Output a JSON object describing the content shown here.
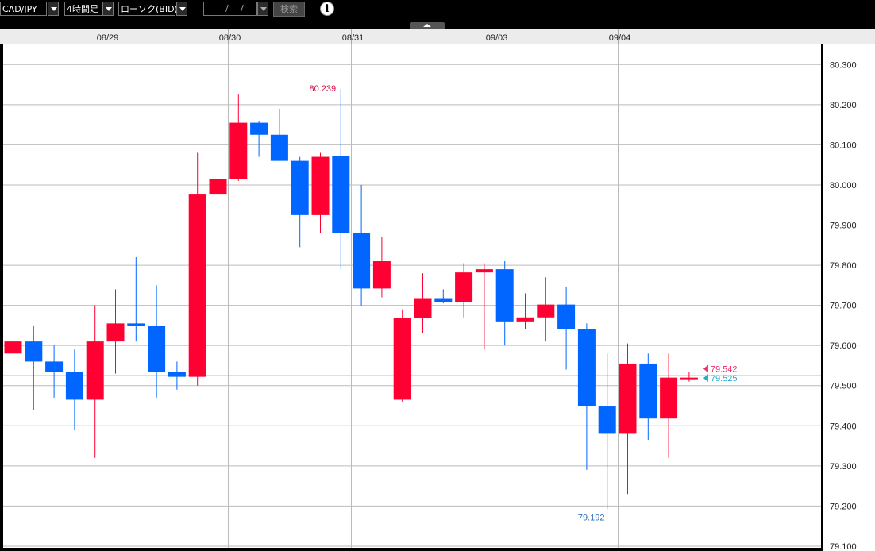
{
  "toolbar": {
    "pair": "CAD/JPY",
    "timeframe": "4時間足",
    "chart_style": "ローソク(BID)",
    "date_placeholder_slash1": "/",
    "date_placeholder_slash2": "/",
    "search_label": "検索",
    "info_label": "i"
  },
  "colors": {
    "up": "#ff0033",
    "down": "#0066ff",
    "grid": "#bbbbbb",
    "price_line": "#ff9933",
    "ask_marker": "#e8306a",
    "bid_marker": "#22aacc",
    "high_label": "#cc1144",
    "low_label": "#2a6fc0"
  },
  "chart_data": {
    "type": "candlestick",
    "x_tick_labels": [
      {
        "label": "08/29",
        "index": 5
      },
      {
        "label": "08/30",
        "index": 11
      },
      {
        "label": "08/31",
        "index": 17
      },
      {
        "label": "09/03",
        "index": 24
      },
      {
        "label": "09/04",
        "index": 30
      }
    ],
    "y_ticks": [
      80.3,
      80.2,
      80.1,
      80.0,
      79.9,
      79.8,
      79.7,
      79.6,
      79.5,
      79.4,
      79.3,
      79.2,
      79.1
    ],
    "y_tick_labels": [
      "80.300",
      "80.200",
      "80.100",
      "80.000",
      "79.900",
      "79.800",
      "79.700",
      "79.600",
      "79.500",
      "79.400",
      "79.300",
      "79.200",
      "79.100"
    ],
    "ylim": [
      79.096,
      80.35
    ],
    "grid": true,
    "candles": [
      {
        "o": 79.58,
        "h": 79.64,
        "l": 79.49,
        "c": 79.61
      },
      {
        "o": 79.61,
        "h": 79.65,
        "l": 79.44,
        "c": 79.56
      },
      {
        "o": 79.56,
        "h": 79.6,
        "l": 79.47,
        "c": 79.535
      },
      {
        "o": 79.535,
        "h": 79.59,
        "l": 79.39,
        "c": 79.465
      },
      {
        "o": 79.465,
        "h": 79.7,
        "l": 79.32,
        "c": 79.61
      },
      {
        "o": 79.61,
        "h": 79.74,
        "l": 79.53,
        "c": 79.655
      },
      {
        "o": 79.655,
        "h": 79.82,
        "l": 79.61,
        "c": 79.648
      },
      {
        "o": 79.648,
        "h": 79.75,
        "l": 79.47,
        "c": 79.535
      },
      {
        "o": 79.535,
        "h": 79.56,
        "l": 79.49,
        "c": 79.522
      },
      {
        "o": 79.522,
        "h": 80.08,
        "l": 79.5,
        "c": 79.978
      },
      {
        "o": 79.978,
        "h": 80.13,
        "l": 79.8,
        "c": 80.015
      },
      {
        "o": 80.015,
        "h": 80.225,
        "l": 80.01,
        "c": 80.155
      },
      {
        "o": 80.155,
        "h": 80.16,
        "l": 80.07,
        "c": 80.125
      },
      {
        "o": 80.125,
        "h": 80.19,
        "l": 80.06,
        "c": 80.06
      },
      {
        "o": 80.06,
        "h": 80.07,
        "l": 79.845,
        "c": 79.925
      },
      {
        "o": 79.925,
        "h": 80.08,
        "l": 79.88,
        "c": 80.07
      },
      {
        "o": 80.072,
        "h": 80.239,
        "l": 79.79,
        "c": 79.88
      },
      {
        "o": 79.88,
        "h": 80.0,
        "l": 79.7,
        "c": 79.742
      },
      {
        "o": 79.742,
        "h": 79.87,
        "l": 79.72,
        "c": 79.81
      },
      {
        "o": 79.465,
        "h": 79.69,
        "l": 79.46,
        "c": 79.668
      },
      {
        "o": 79.668,
        "h": 79.78,
        "l": 79.63,
        "c": 79.718
      },
      {
        "o": 79.718,
        "h": 79.74,
        "l": 79.705,
        "c": 79.708
      },
      {
        "o": 79.708,
        "h": 79.805,
        "l": 79.67,
        "c": 79.782
      },
      {
        "o": 79.782,
        "h": 79.805,
        "l": 79.59,
        "c": 79.79
      },
      {
        "o": 79.79,
        "h": 79.81,
        "l": 79.6,
        "c": 79.66
      },
      {
        "o": 79.66,
        "h": 79.73,
        "l": 79.64,
        "c": 79.67
      },
      {
        "o": 79.67,
        "h": 79.77,
        "l": 79.61,
        "c": 79.702
      },
      {
        "o": 79.702,
        "h": 79.745,
        "l": 79.54,
        "c": 79.64
      },
      {
        "o": 79.64,
        "h": 79.655,
        "l": 79.29,
        "c": 79.45
      },
      {
        "o": 79.45,
        "h": 79.58,
        "l": 79.192,
        "c": 79.38
      },
      {
        "o": 79.38,
        "h": 79.605,
        "l": 79.23,
        "c": 79.555
      },
      {
        "o": 79.555,
        "h": 79.58,
        "l": 79.365,
        "c": 79.418
      },
      {
        "o": 79.418,
        "h": 79.58,
        "l": 79.32,
        "c": 79.52
      },
      {
        "o": 79.52,
        "h": 79.535,
        "l": 79.51,
        "c": 79.52
      }
    ],
    "annotations": {
      "high_label": "80.239",
      "high_value": 80.239,
      "high_index": 16,
      "low_label": "79.192",
      "low_value": 79.192,
      "low_index": 29
    },
    "current_price_line": 79.525,
    "markers": {
      "ask": {
        "label": "79.542",
        "value": 79.542
      },
      "bid": {
        "label": "79.525",
        "value": 79.525
      }
    }
  }
}
